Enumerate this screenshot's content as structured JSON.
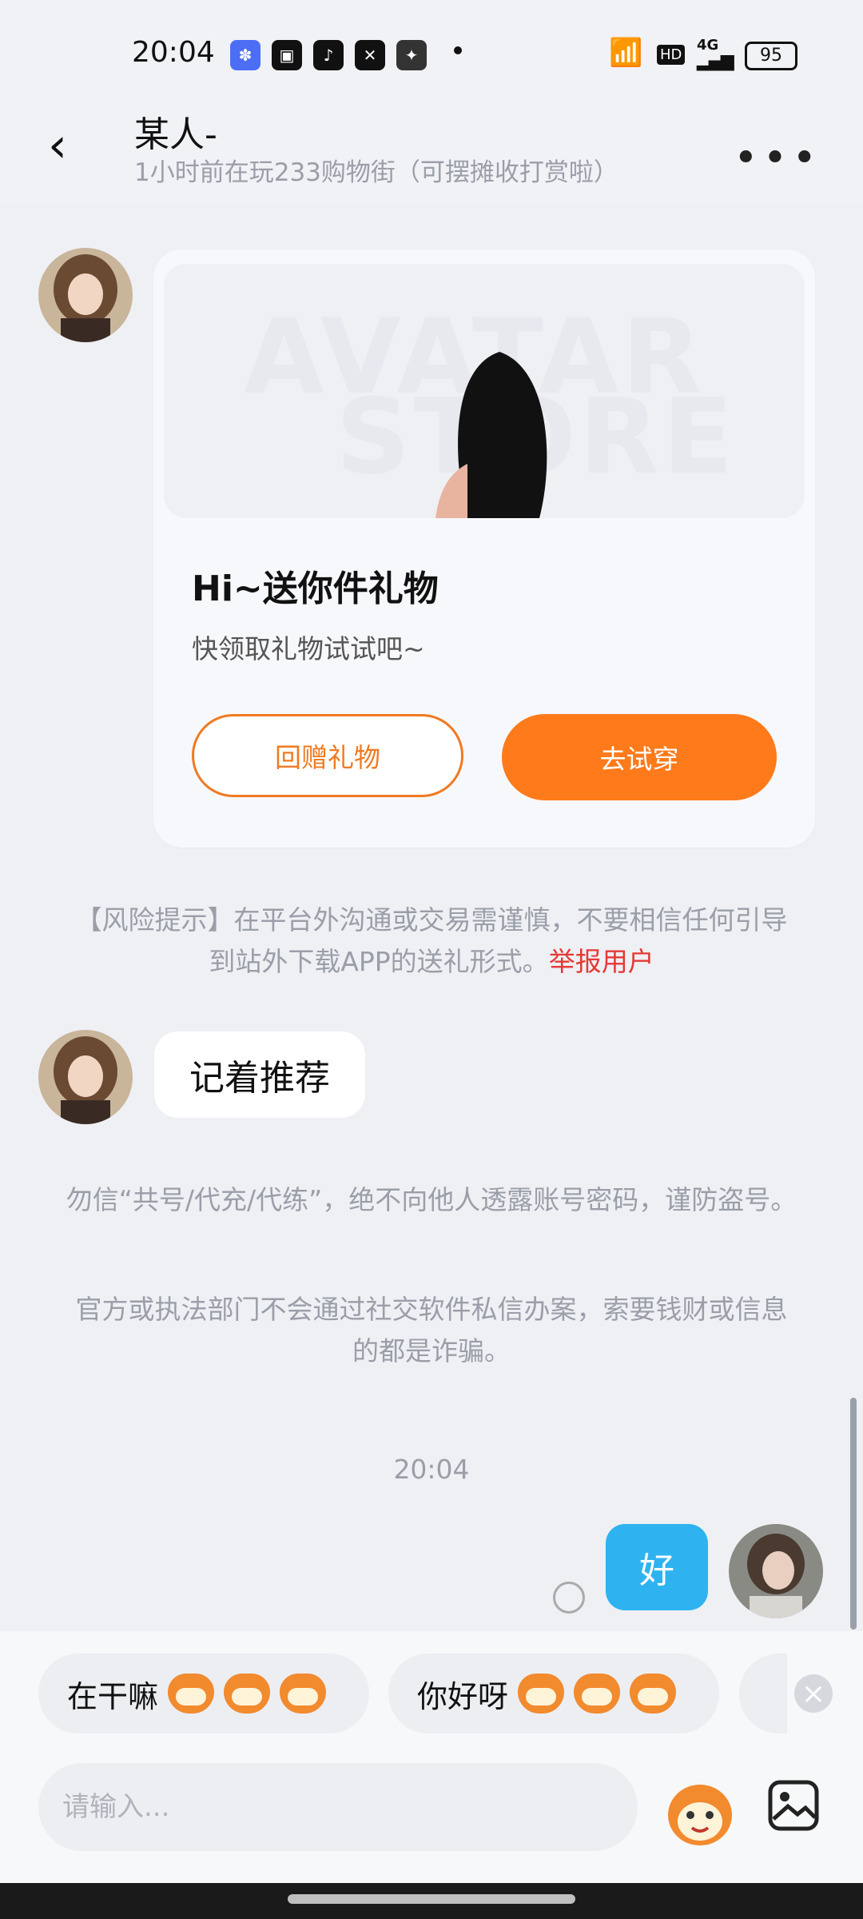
{
  "status_bar": {
    "time": "20:04",
    "battery": "95",
    "network": "4G",
    "hd": "HD"
  },
  "header": {
    "title": "某人-",
    "subtitle": "1小时前在玩233购物街（可摆摊收打赏啦）"
  },
  "gift_card": {
    "watermark_line1": "AVATAR",
    "watermark_line2": "STORE",
    "title": "Hi~送你件礼物",
    "description": "快领取礼物试试吧~",
    "return_button": "回赠礼物",
    "try_button": "去试穿"
  },
  "risk_notice": {
    "text": "【风险提示】在平台外沟通或交易需谨慎，不要相信任何引导到站外下载APP的送礼形式。",
    "report_link": "举报用户"
  },
  "messages": {
    "incoming": "记着推荐",
    "warning1": "勿信“共号/代充/代练”，绝不向他人透露账号密码，谨防盗号。",
    "warning2": "官方或执法部门不会通过社交软件私信办案，索要钱财或信息的都是诈骗。",
    "time": "20:04",
    "outgoing": "好"
  },
  "quick_replies": [
    {
      "text": "在干嘛"
    },
    {
      "text": "你好呀"
    }
  ],
  "input": {
    "placeholder": "请输入..."
  },
  "colors": {
    "accent": "#ff7a1a",
    "outgoing_bubble": "#2eb3f0",
    "report": "#e53935"
  }
}
